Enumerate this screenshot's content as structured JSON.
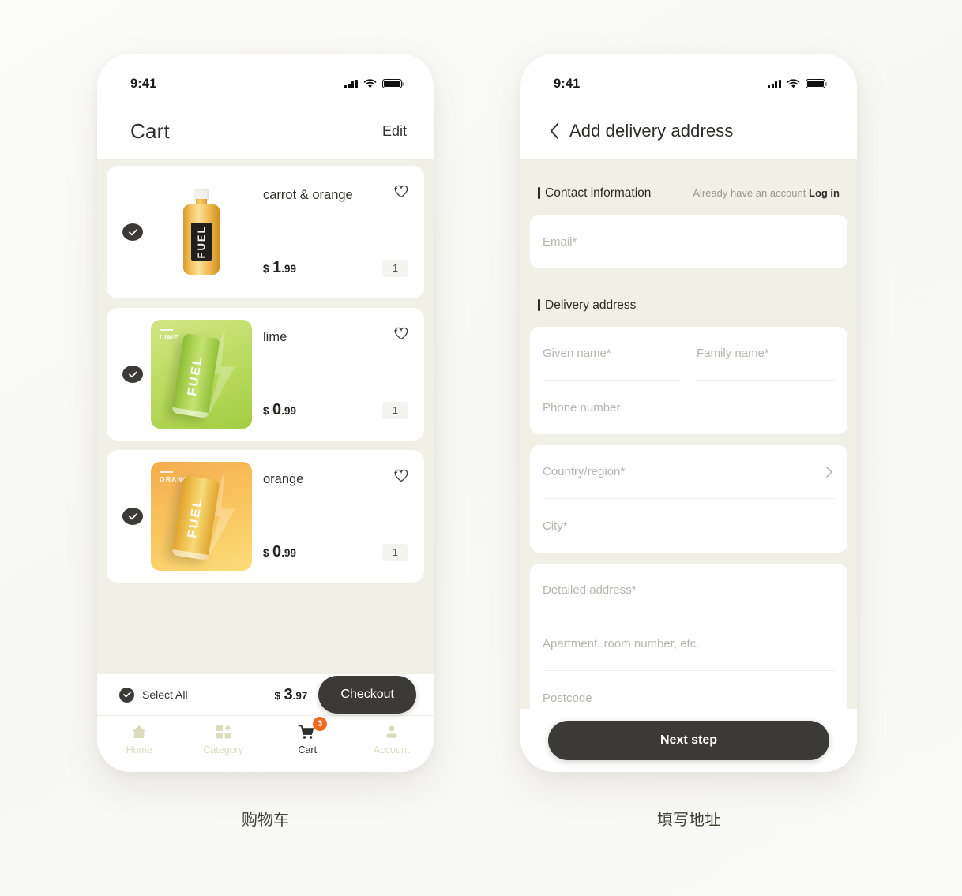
{
  "screens": [
    {
      "caption": "购物车",
      "status_bar": {
        "time": "9:41",
        "signal_icon": "cellular-signal-icon",
        "wifi_icon": "wifi-icon",
        "battery_icon": "battery-icon"
      },
      "header": {
        "title": "Cart",
        "action": "Edit"
      },
      "items": [
        {
          "name": "carrot & orange",
          "price_currency": "$",
          "price_int": "1",
          "price_dec": ".99",
          "qty": "1",
          "selected": true,
          "thumb_type": "bottle",
          "thumb_label": "FUEL",
          "flavour_tag": ""
        },
        {
          "name": "lime",
          "price_currency": "$",
          "price_int": "0",
          "price_dec": ".99",
          "qty": "1",
          "selected": true,
          "thumb_type": "can",
          "thumb_label": "FUEL",
          "flavour_tag": "LIME"
        },
        {
          "name": "orange",
          "price_currency": "$",
          "price_int": "0",
          "price_dec": ".99",
          "qty": "1",
          "selected": true,
          "thumb_type": "can",
          "thumb_label": "FUEL",
          "flavour_tag": "ORANGE"
        }
      ],
      "bottom_bar": {
        "select_all_label": "Select All",
        "select_all_checked": true,
        "total_currency": "$",
        "total_int": "3",
        "total_dec": ".97",
        "checkout_label": "Checkout"
      },
      "tabbar": [
        {
          "label": "Home",
          "icon": "home-icon",
          "active": false,
          "badge": ""
        },
        {
          "label": "Category",
          "icon": "category-icon",
          "active": false,
          "badge": ""
        },
        {
          "label": "Cart",
          "icon": "cart-icon",
          "active": true,
          "badge": "3"
        },
        {
          "label": "Account",
          "icon": "account-icon",
          "active": false,
          "badge": ""
        }
      ]
    },
    {
      "caption": "填写地址",
      "status_bar": {
        "time": "9:41",
        "signal_icon": "cellular-signal-icon",
        "wifi_icon": "wifi-icon",
        "battery_icon": "battery-icon"
      },
      "header": {
        "title": "Add delivery address",
        "back_icon": "back-chevron-icon"
      },
      "contact_section": {
        "title": "Contact information",
        "note_text": "Already have an account",
        "note_link": "Log in",
        "email_placeholder": "Email*"
      },
      "delivery_section": {
        "title": "Delivery address",
        "given_name_placeholder": "Given name*",
        "family_name_placeholder": "Family name*",
        "phone_placeholder": "Phone number",
        "country_placeholder": "Country/region*",
        "country_chevron_icon": "chevron-right-icon",
        "city_placeholder": "City*",
        "detailed_placeholder": "Detailed address*",
        "apartment_placeholder": "Apartment, room number, etc.",
        "postcode_placeholder": "Postcode"
      },
      "next_button": "Next step"
    }
  ],
  "colors": {
    "page_bg": "#fafaf8",
    "panel_bg": "#f0f0e6",
    "card_bg": "#ffffff",
    "dark": "#3b3a36",
    "badge_orange": "#f26a21",
    "inactive_tab": "#dedcbf",
    "placeholder": "#b6b5ae",
    "lime_tile_start": "#cfe27a",
    "lime_tile_end": "#a9d14a",
    "orange_tile_start": "#f6b861",
    "orange_tile_end": "#f8d86a"
  }
}
